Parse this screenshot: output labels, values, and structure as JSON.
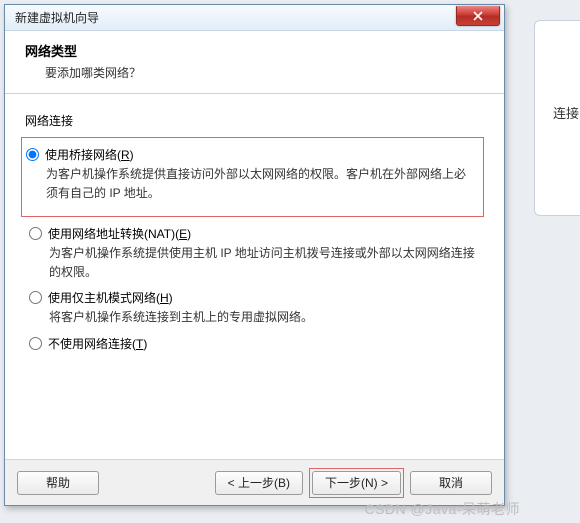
{
  "titlebar": {
    "title": "新建虚拟机向导"
  },
  "header": {
    "title": "网络类型",
    "subtitle": "要添加哪类网络？"
  },
  "section_label": "网络连接",
  "options": {
    "bridged": {
      "label_pre": "使用桥接网络(",
      "key": "R",
      "label_post": ")",
      "desc": "为客户机操作系统提供直接访问外部以太网网络的权限。客户机在外部网络上必须有自己的 IP 地址。"
    },
    "nat": {
      "label_pre": "使用网络地址转换(NAT)(",
      "key": "E",
      "label_post": ")",
      "desc": "为客户机操作系统提供使用主机 IP 地址访问主机拨号连接或外部以太网网络连接的权限。"
    },
    "hostonly": {
      "label_pre": "使用仅主机模式网络(",
      "key": "H",
      "label_post": ")",
      "desc": "将客户机操作系统连接到主机上的专用虚拟网络。"
    },
    "none": {
      "label_pre": "不使用网络连接(",
      "key": "T",
      "label_post": ")"
    }
  },
  "buttons": {
    "help": "帮助",
    "back": "< 上一步(B)",
    "next": "下一步(N) >",
    "cancel": "取消"
  },
  "side_panel": {
    "text": "连接"
  },
  "watermark": "CSDN @Java-呆萌老师"
}
